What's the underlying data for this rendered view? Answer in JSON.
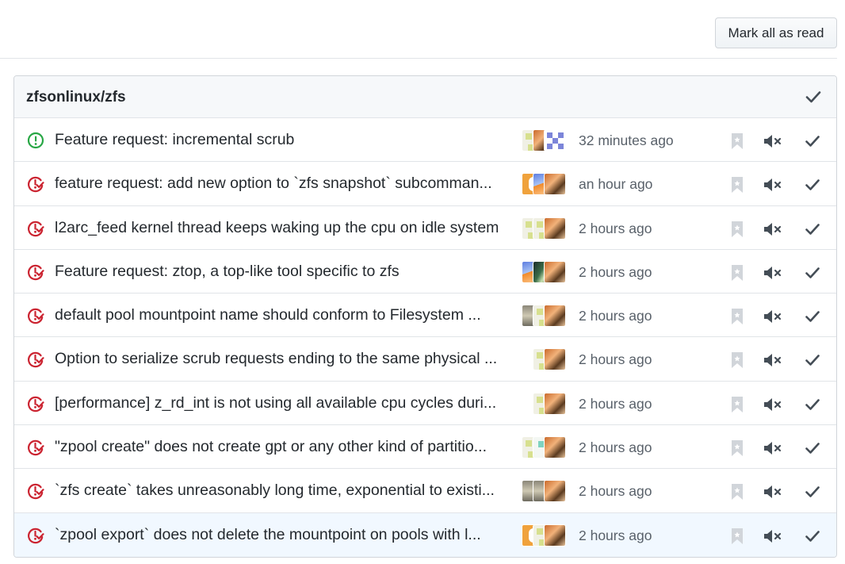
{
  "toolbar": {
    "mark_all_label": "Mark all as read"
  },
  "repo": {
    "name": "zfsonlinux/zfs"
  },
  "colors": {
    "open_issue": "#28a745",
    "closed_issue": "#cb2431",
    "muted_icon": "#444d56",
    "bookmark": "#d1d5da",
    "highlight_row": "#f1f8ff"
  },
  "icons": {
    "open": "issue-opened-icon",
    "closed": "issue-closed-icon",
    "bookmark": "bookmark-icon",
    "mute": "mute-icon",
    "done": "check-icon"
  },
  "notifications": [
    {
      "title": "Feature request: incremental scrub",
      "time": "32 minutes ago",
      "state": "open",
      "avatars": [
        "a1",
        "a3",
        "a2"
      ]
    },
    {
      "title": "feature request: add new option to `zfs snapshot` subcomman...",
      "time": "an hour ago",
      "state": "closed",
      "avatars": [
        "a8",
        "a4",
        "a3"
      ]
    },
    {
      "title": "l2arc_feed kernel thread keeps waking up the cpu on idle system",
      "time": "2 hours ago",
      "state": "closed",
      "avatars": [
        "a1",
        "a1",
        "a3"
      ]
    },
    {
      "title": "Feature request: ztop, a top-like tool specific to zfs",
      "time": "2 hours ago",
      "state": "closed",
      "avatars": [
        "a4",
        "a5",
        "a3"
      ]
    },
    {
      "title": "default pool mountpoint name should conform to Filesystem ...",
      "time": "2 hours ago",
      "state": "closed",
      "avatars": [
        "a6",
        "a1",
        "a3"
      ]
    },
    {
      "title": "Option to serialize scrub requests ending to the same physical ...",
      "time": "2 hours ago",
      "state": "closed",
      "avatars": [
        "a1",
        "a3"
      ]
    },
    {
      "title": "[performance] z_rd_int is not using all available cpu cycles duri...",
      "time": "2 hours ago",
      "state": "closed",
      "avatars": [
        "a1",
        "a3"
      ]
    },
    {
      "title": "\"zpool create\" does not create gpt or any other kind of partitio...",
      "time": "2 hours ago",
      "state": "closed",
      "avatars": [
        "a1",
        "a7",
        "a3"
      ]
    },
    {
      "title": "`zfs create` takes unreasonably long time, exponential to existi...",
      "time": "2 hours ago",
      "state": "closed",
      "avatars": [
        "a6",
        "a6",
        "a3"
      ]
    },
    {
      "title": "`zpool export` does not delete the mountpoint on pools with l...",
      "time": "2 hours ago",
      "state": "closed",
      "avatars": [
        "a8",
        "a1",
        "a3"
      ],
      "highlighted": true
    }
  ]
}
